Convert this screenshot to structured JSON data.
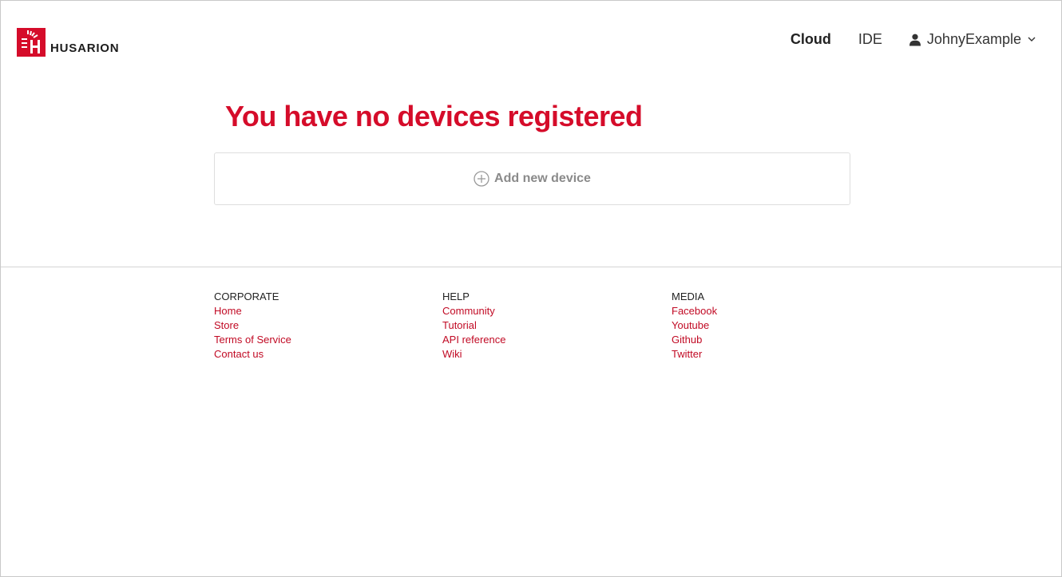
{
  "brand": {
    "name": "HUSARION",
    "color": "#d50c2a",
    "icon": "husarion-logo-icon"
  },
  "nav": {
    "items": [
      {
        "label": "Cloud",
        "active": true
      },
      {
        "label": "IDE",
        "active": false
      }
    ],
    "user": {
      "name": "JohnyExample",
      "icon": "user-icon",
      "menu_icon": "chevron-down-icon"
    }
  },
  "main": {
    "title": "You have no devices registered",
    "add_device": {
      "label": "Add new device",
      "icon": "plus-circle-icon"
    }
  },
  "footer": {
    "columns": [
      {
        "heading": "CORPORATE",
        "links": [
          "Home",
          "Store",
          "Terms of Service",
          "Contact us"
        ]
      },
      {
        "heading": "HELP",
        "links": [
          "Community",
          "Tutorial",
          "API reference",
          "Wiki"
        ]
      },
      {
        "heading": "MEDIA",
        "links": [
          "Facebook",
          "Youtube",
          "Github",
          "Twitter"
        ]
      }
    ],
    "link_color": "#c10a24"
  }
}
